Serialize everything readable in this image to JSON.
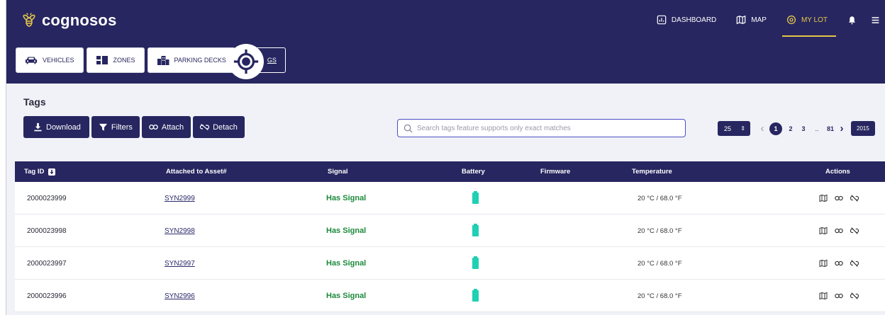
{
  "app": {
    "name": "cognosos",
    "brand_color": "#272660",
    "accent_color": "#e5c64a"
  },
  "nav": {
    "items": [
      {
        "label": "DASHBOARD",
        "icon": "dashboard-icon"
      },
      {
        "label": "MAP",
        "icon": "map-icon"
      },
      {
        "label": "MY LOT",
        "icon": "location-pin-icon",
        "active": true
      }
    ],
    "bell_icon": "bell-icon",
    "menu_icon": "hamburger-menu-icon"
  },
  "tabs": [
    {
      "label": "VEHICLES",
      "icon": "car-icon"
    },
    {
      "label": "ZONES",
      "icon": "zones-icon"
    },
    {
      "label": "PARKING DECKS",
      "icon": "building-icon"
    },
    {
      "label": "GS",
      "icon": "target-icon",
      "active": true
    }
  ],
  "page": {
    "title": "Tags"
  },
  "toolbar": {
    "download_label": "Download",
    "filters_label": "Filters",
    "attach_label": "Attach",
    "detach_label": "Detach"
  },
  "search": {
    "placeholder": "Search tags feature supports only exact matches",
    "value": ""
  },
  "pagination": {
    "page_size": "25",
    "pages": [
      "1",
      "2",
      "3"
    ],
    "current": "1",
    "ellipsis": "..",
    "last_shown": "81",
    "total_label": "2015"
  },
  "table": {
    "columns": [
      "Tag ID",
      "Attached to Asset#",
      "Signal",
      "Battery",
      "Firmware",
      "Temperature",
      "Actions"
    ],
    "rows": [
      {
        "tag_id": "2000023999",
        "asset": "SYN2999",
        "signal": "Has Signal",
        "battery": "full",
        "firmware": "",
        "temperature": "20 °C / 68.0 °F"
      },
      {
        "tag_id": "2000023998",
        "asset": "SYN2998",
        "signal": "Has Signal",
        "battery": "full",
        "firmware": "",
        "temperature": "20 °C / 68.0 °F"
      },
      {
        "tag_id": "2000023997",
        "asset": "SYN2997",
        "signal": "Has Signal",
        "battery": "full",
        "firmware": "",
        "temperature": "20 °C / 68.0 °F"
      },
      {
        "tag_id": "2000023996",
        "asset": "SYN2996",
        "signal": "Has Signal",
        "battery": "full",
        "firmware": "",
        "temperature": "20 °C / 68.0 °F"
      }
    ],
    "signal_color": "#1b8a3a",
    "battery_color": "#1fd0b4"
  }
}
